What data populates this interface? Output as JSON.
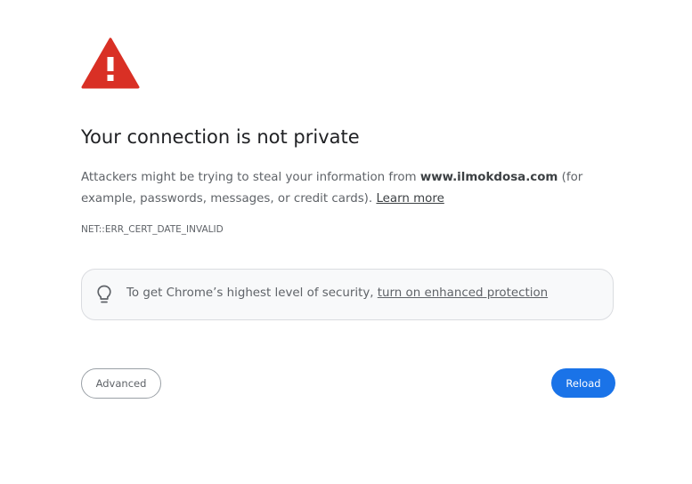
{
  "icons": {
    "warning": "warning-triangle-icon",
    "bulb": "lightbulb-icon"
  },
  "colors": {
    "warning_red": "#d93025",
    "primary_blue": "#1a73e8"
  },
  "interstitial": {
    "title": "Your connection is not private",
    "message_prefix": "Attackers might be trying to steal your information from ",
    "domain": "www.ilmokdosa.com",
    "message_suffix": " (for example, passwords, messages, or credit cards). ",
    "learn_more": "Learn more",
    "error_code": "NET::ERR_CERT_DATE_INVALID"
  },
  "security_tip": {
    "text": "To get Chrome’s highest level of security, ",
    "link": "turn on enhanced protection"
  },
  "buttons": {
    "advanced": "Advanced",
    "reload": "Reload"
  }
}
